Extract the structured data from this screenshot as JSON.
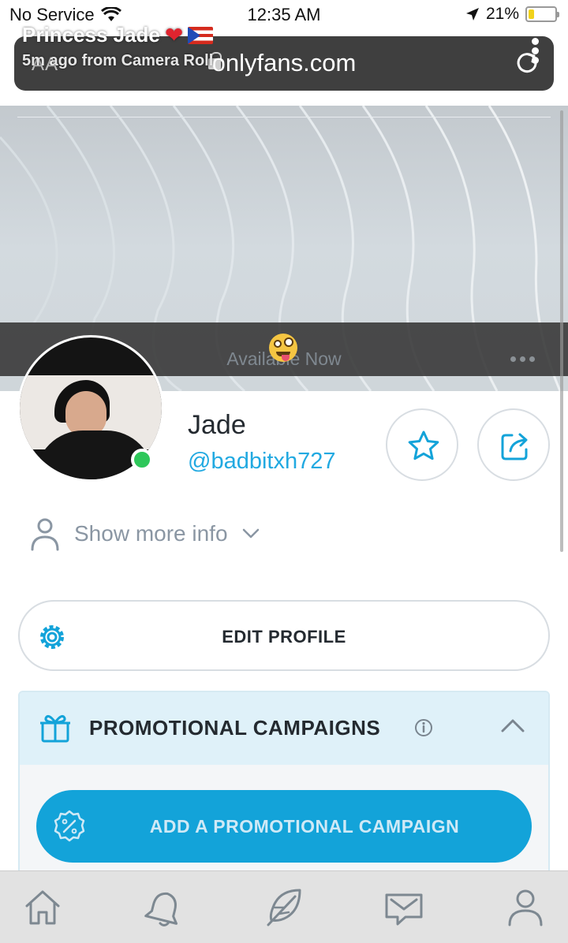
{
  "status_bar": {
    "carrier": "No Service",
    "time": "12:35 AM",
    "battery_text": "21%",
    "battery_level": 0.21
  },
  "browser": {
    "aa_label": "AA",
    "url": "onlyfans.com"
  },
  "snap_overlay": {
    "name": "Princess Jade",
    "subtitle": "5m ago from Camera Roll"
  },
  "cover": {
    "caption": "Available Now"
  },
  "profile": {
    "name": "Jade",
    "handle": "@badbitxh727",
    "more_info": "Show more info",
    "online": true
  },
  "buttons": {
    "edit_profile": "EDIT PROFILE",
    "add_campaign": "ADD A PROMOTIONAL CAMPAIGN"
  },
  "promo": {
    "title": "PROMOTIONAL CAMPAIGNS"
  },
  "nav": {
    "items": [
      "home-icon",
      "bell-icon",
      "feather-icon",
      "message-icon",
      "user-icon"
    ]
  },
  "colors": {
    "accent": "#13a3d9",
    "link": "#21a9e1",
    "online": "#2ec75a"
  }
}
